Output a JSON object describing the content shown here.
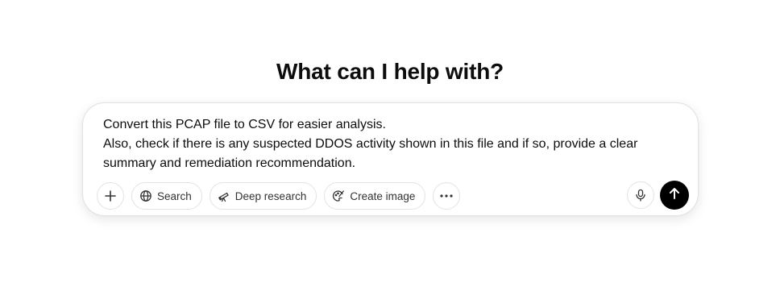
{
  "heading": "What can I help with?",
  "composer": {
    "prompt_lines": [
      "Convert this PCAP file to CSV for easier analysis.",
      "Also, check if there is any suspected DDOS activity shown in this file and if so, provide a clear",
      "summary and remediation recommendation."
    ]
  },
  "toolbar": {
    "attach_icon": "plus-icon",
    "search_label": "Search",
    "search_icon": "globe-icon",
    "deep_research_label": "Deep research",
    "deep_research_icon": "telescope-icon",
    "create_image_label": "Create image",
    "create_image_icon": "palette-icon",
    "more_icon": "ellipsis-icon",
    "voice_icon": "microphone-icon",
    "send_icon": "arrow-up-icon"
  },
  "colors": {
    "send_button": "#000000",
    "border": "#e3e3e3",
    "text": "#0d0d0d"
  }
}
